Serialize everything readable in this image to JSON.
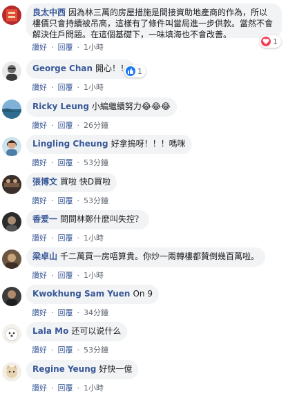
{
  "actions": {
    "like": "讚好",
    "reply": "回覆"
  },
  "comments": [
    {
      "author": "良太中西",
      "text": "因為林三萬的房屋措施是間接資助地產商的作為，所以樓價只會持續被吊高，這樣有了條件叫當局進一步供款。當然不會解決住戶問題。在這個基礎下，一味填海也不會改善。",
      "time": "1小時",
      "reaction_count": "1",
      "reaction_icon": "love-reaction-icon"
    },
    {
      "author": "George Chan",
      "text": "開心！！",
      "time": "1小時",
      "reaction_count": "1",
      "reaction_icon": "like-reaction-icon"
    },
    {
      "author": "Ricky Leung",
      "text": "小編繼續努力😂😂😂",
      "time": "26分鐘"
    },
    {
      "author": "Lingling Cheung",
      "text": "好拿摀呀！！！嗎咪",
      "time": "53分鐘"
    },
    {
      "author": "張博文",
      "text": "買啦 快D買啦",
      "time": "53分鐘"
    },
    {
      "author": "香爱一",
      "text": "問問林鄭什麼叫失控？",
      "time": "1小時"
    },
    {
      "author": "梁卓山",
      "text": "千二萬買一房唔算貴。你炒一兩轉樓都贊倒幾百萬啦。",
      "time": "1小時"
    },
    {
      "author": "Kwokhung Sam Yuen",
      "text": "On 9",
      "time": "34分鐘"
    },
    {
      "author": "Lala Mo",
      "text": "还可以说什么",
      "time": "53分鐘"
    },
    {
      "author": "Regine Yeung",
      "text": "好快一億",
      "time": "1小時"
    }
  ],
  "colors": {
    "author": "#385898",
    "bubble": "#f2f3f5",
    "meta": "#606770",
    "like_reaction": "#1877f2",
    "love_reaction": "#f33e58"
  }
}
